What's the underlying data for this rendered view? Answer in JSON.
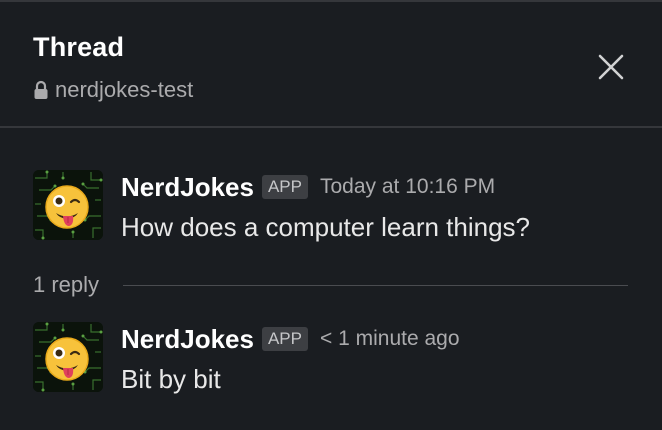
{
  "header": {
    "title": "Thread",
    "channel": "nerdjokes-test",
    "channel_icon": "lock-icon",
    "close_icon": "close-icon"
  },
  "messages": [
    {
      "sender": "NerdJokes",
      "badge": "APP",
      "timestamp": "Today at 10:16 PM",
      "text": "How does a computer learn things?",
      "avatar": "nerd-face-emoji-avatar"
    },
    {
      "sender": "NerdJokes",
      "badge": "APP",
      "timestamp": "< 1 minute ago",
      "text": "Bit by bit",
      "avatar": "nerd-face-emoji-avatar"
    }
  ],
  "replies": {
    "label": "1 reply"
  },
  "colors": {
    "background": "#1a1d21",
    "divider": "#35373b",
    "text_primary": "#ffffff",
    "text_secondary": "#ababad",
    "badge_bg": "#3d3f43"
  }
}
